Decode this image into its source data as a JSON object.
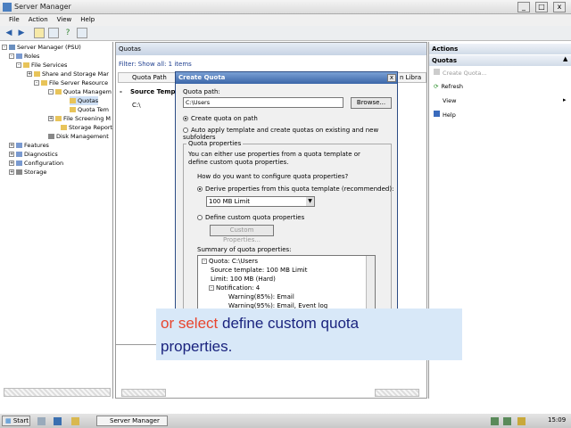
{
  "window": {
    "title": "Server Manager",
    "minimize": "_",
    "maximize": "□",
    "close": "x"
  },
  "menu": {
    "file": "File",
    "action": "Action",
    "view": "View",
    "help": "Help"
  },
  "tree": {
    "root": "Server Manager (PSU)",
    "roles": "Roles",
    "file_services": "File Services",
    "share_storage": "Share and Storage Mar",
    "fsrm": "File Server Resource",
    "quota_mgmt": "Quota Managem",
    "quotas": "Quotas",
    "quota_templates": "Quota Tem",
    "file_screening": "File Screening M",
    "storage_reports": "Storage Report",
    "disk_mgmt": "Disk Management",
    "features": "Features",
    "diagnostics": "Diagnostics",
    "configuration": "Configuration",
    "storage": "Storage"
  },
  "center": {
    "panel_title": "Quotas",
    "filter": "Filter: Show all: 1 items",
    "col_quota_path": "Quota Path",
    "col_source": "Source Templ",
    "row_path": "C:\\",
    "right_col": "n Libra"
  },
  "actions": {
    "header": "Actions",
    "section": "Quotas",
    "create_quota": "Create Quota...",
    "refresh": "Refresh",
    "view": "View",
    "help": "Help"
  },
  "dialog": {
    "title": "Create Quota",
    "close": "x",
    "quota_path_label": "Quota path:",
    "quota_path_value": "C:\\Users",
    "browse": "Browse...",
    "opt_create": "Create quota on path",
    "opt_auto": "Auto apply template and create quotas on existing and new subfolders",
    "group_title": "Quota properties",
    "group_desc": "You can either use properties from a quota template or define custom quota properties.",
    "question": "How do you want to configure quota properties?",
    "opt_derive": "Derive properties from this quota template (recommended):",
    "template_value": "100 MB Limit",
    "opt_custom": "Define custom quota properties",
    "custom_btn": "Custom Properties...",
    "summary_label": "Summary of quota properties:",
    "summary_items": [
      "Quota: C:\\Users",
      "Source template: 100 MB Limit",
      "Limit: 100 MB (Hard)",
      "Notification: 4",
      "Warning(85%): Email",
      "Warning(95%): Email, Event log"
    ]
  },
  "caption": {
    "part1": "or select ",
    "part2": "define custom quota",
    "part3": "properties."
  },
  "taskbar": {
    "start": "Start",
    "task": "Server Manager",
    "clock": "15:09"
  }
}
